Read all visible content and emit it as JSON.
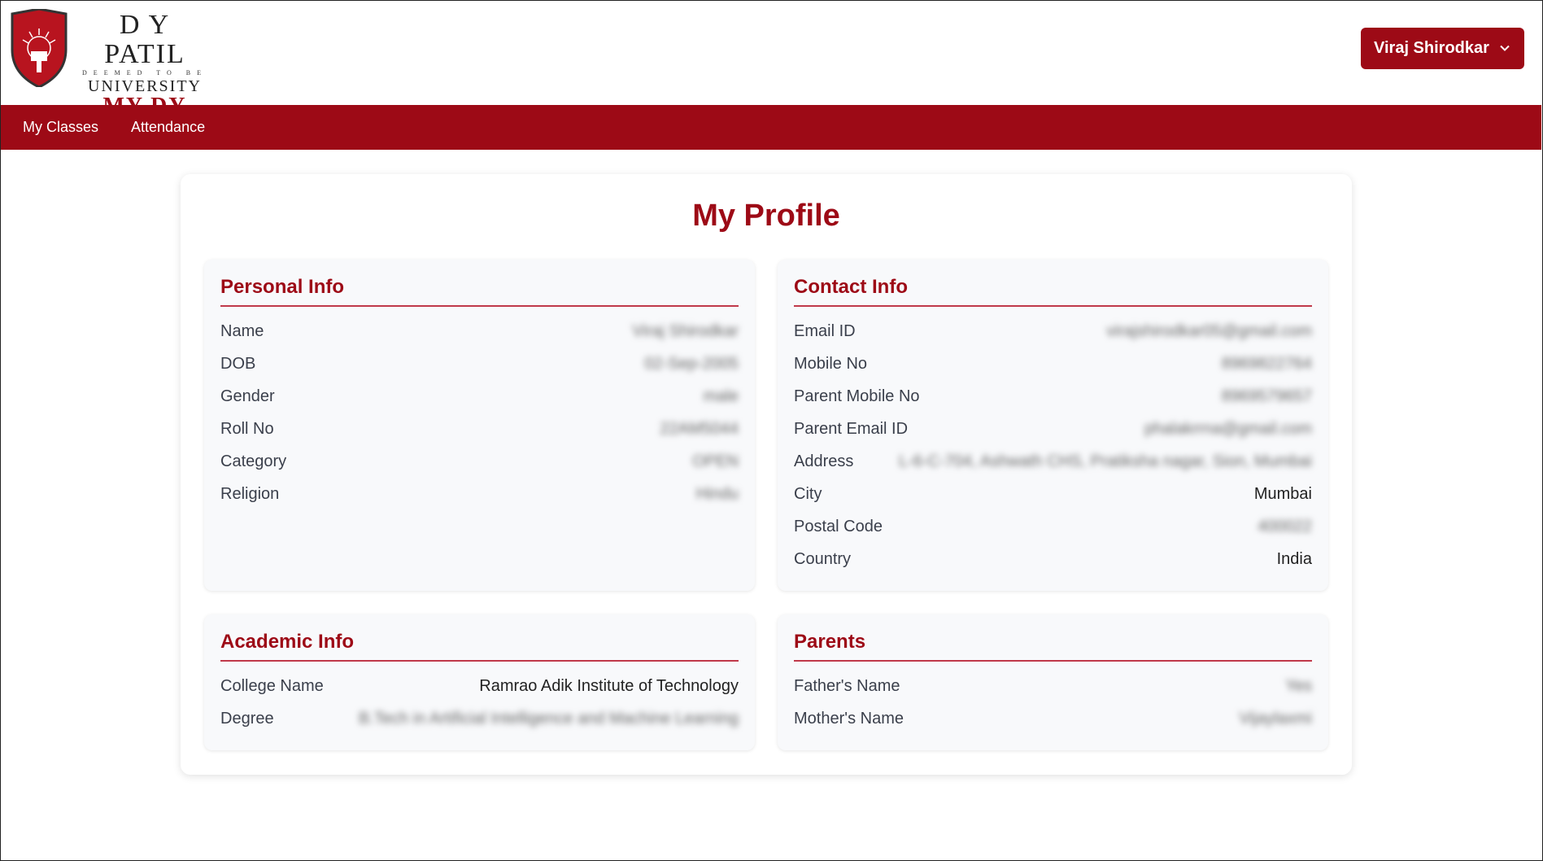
{
  "logo": {
    "line1": "D Y PATIL",
    "line2": "DEEMED TO BE",
    "line3": "UNIVERSITY",
    "line4": "MY DY"
  },
  "user_menu": {
    "label": "Viraj Shirodkar"
  },
  "nav": {
    "items": [
      "My Classes",
      "Attendance"
    ]
  },
  "page_title": "My Profile",
  "personal": {
    "title": "Personal Info",
    "rows": [
      {
        "label": "Name",
        "value": "Viraj Shirodkar"
      },
      {
        "label": "DOB",
        "value": "02-Sep-2005"
      },
      {
        "label": "Gender",
        "value": "male"
      },
      {
        "label": "Roll No",
        "value": "22AM5044"
      },
      {
        "label": "Category",
        "value": "OPEN"
      },
      {
        "label": "Religion",
        "value": "Hindu"
      }
    ]
  },
  "contact": {
    "title": "Contact Info",
    "rows": [
      {
        "label": "Email ID",
        "value": "virajshirodkar05@gmail.com"
      },
      {
        "label": "Mobile No",
        "value": "8969822764"
      },
      {
        "label": "Parent Mobile No",
        "value": "8969579657"
      },
      {
        "label": "Parent Email ID",
        "value": "phalakrrna@gmail.com"
      },
      {
        "label": "Address",
        "value": "L-6-C-704, Ashwath CHS, Pratiksha nagar, Sion, Mumbai"
      },
      {
        "label": "City",
        "value": "Mumbai"
      },
      {
        "label": "Postal Code",
        "value": "400022"
      },
      {
        "label": "Country",
        "value": "India"
      }
    ]
  },
  "academic": {
    "title": "Academic Info",
    "rows": [
      {
        "label": "College Name",
        "value": "Ramrao Adik Institute of Technology"
      },
      {
        "label": "Degree",
        "value": "B.Tech in Artificial Intelligence and Machine Learning"
      }
    ]
  },
  "parents": {
    "title": "Parents",
    "rows": [
      {
        "label": "Father's Name",
        "value": "Yes"
      },
      {
        "label": "Mother's Name",
        "value": "Vijaylaxmi"
      }
    ]
  },
  "colors": {
    "brand": "#9d0a16",
    "section_bg": "#f8f9fb"
  },
  "icons": {
    "dropdown": "chevron-down-icon",
    "logo": "university-shield-icon"
  }
}
